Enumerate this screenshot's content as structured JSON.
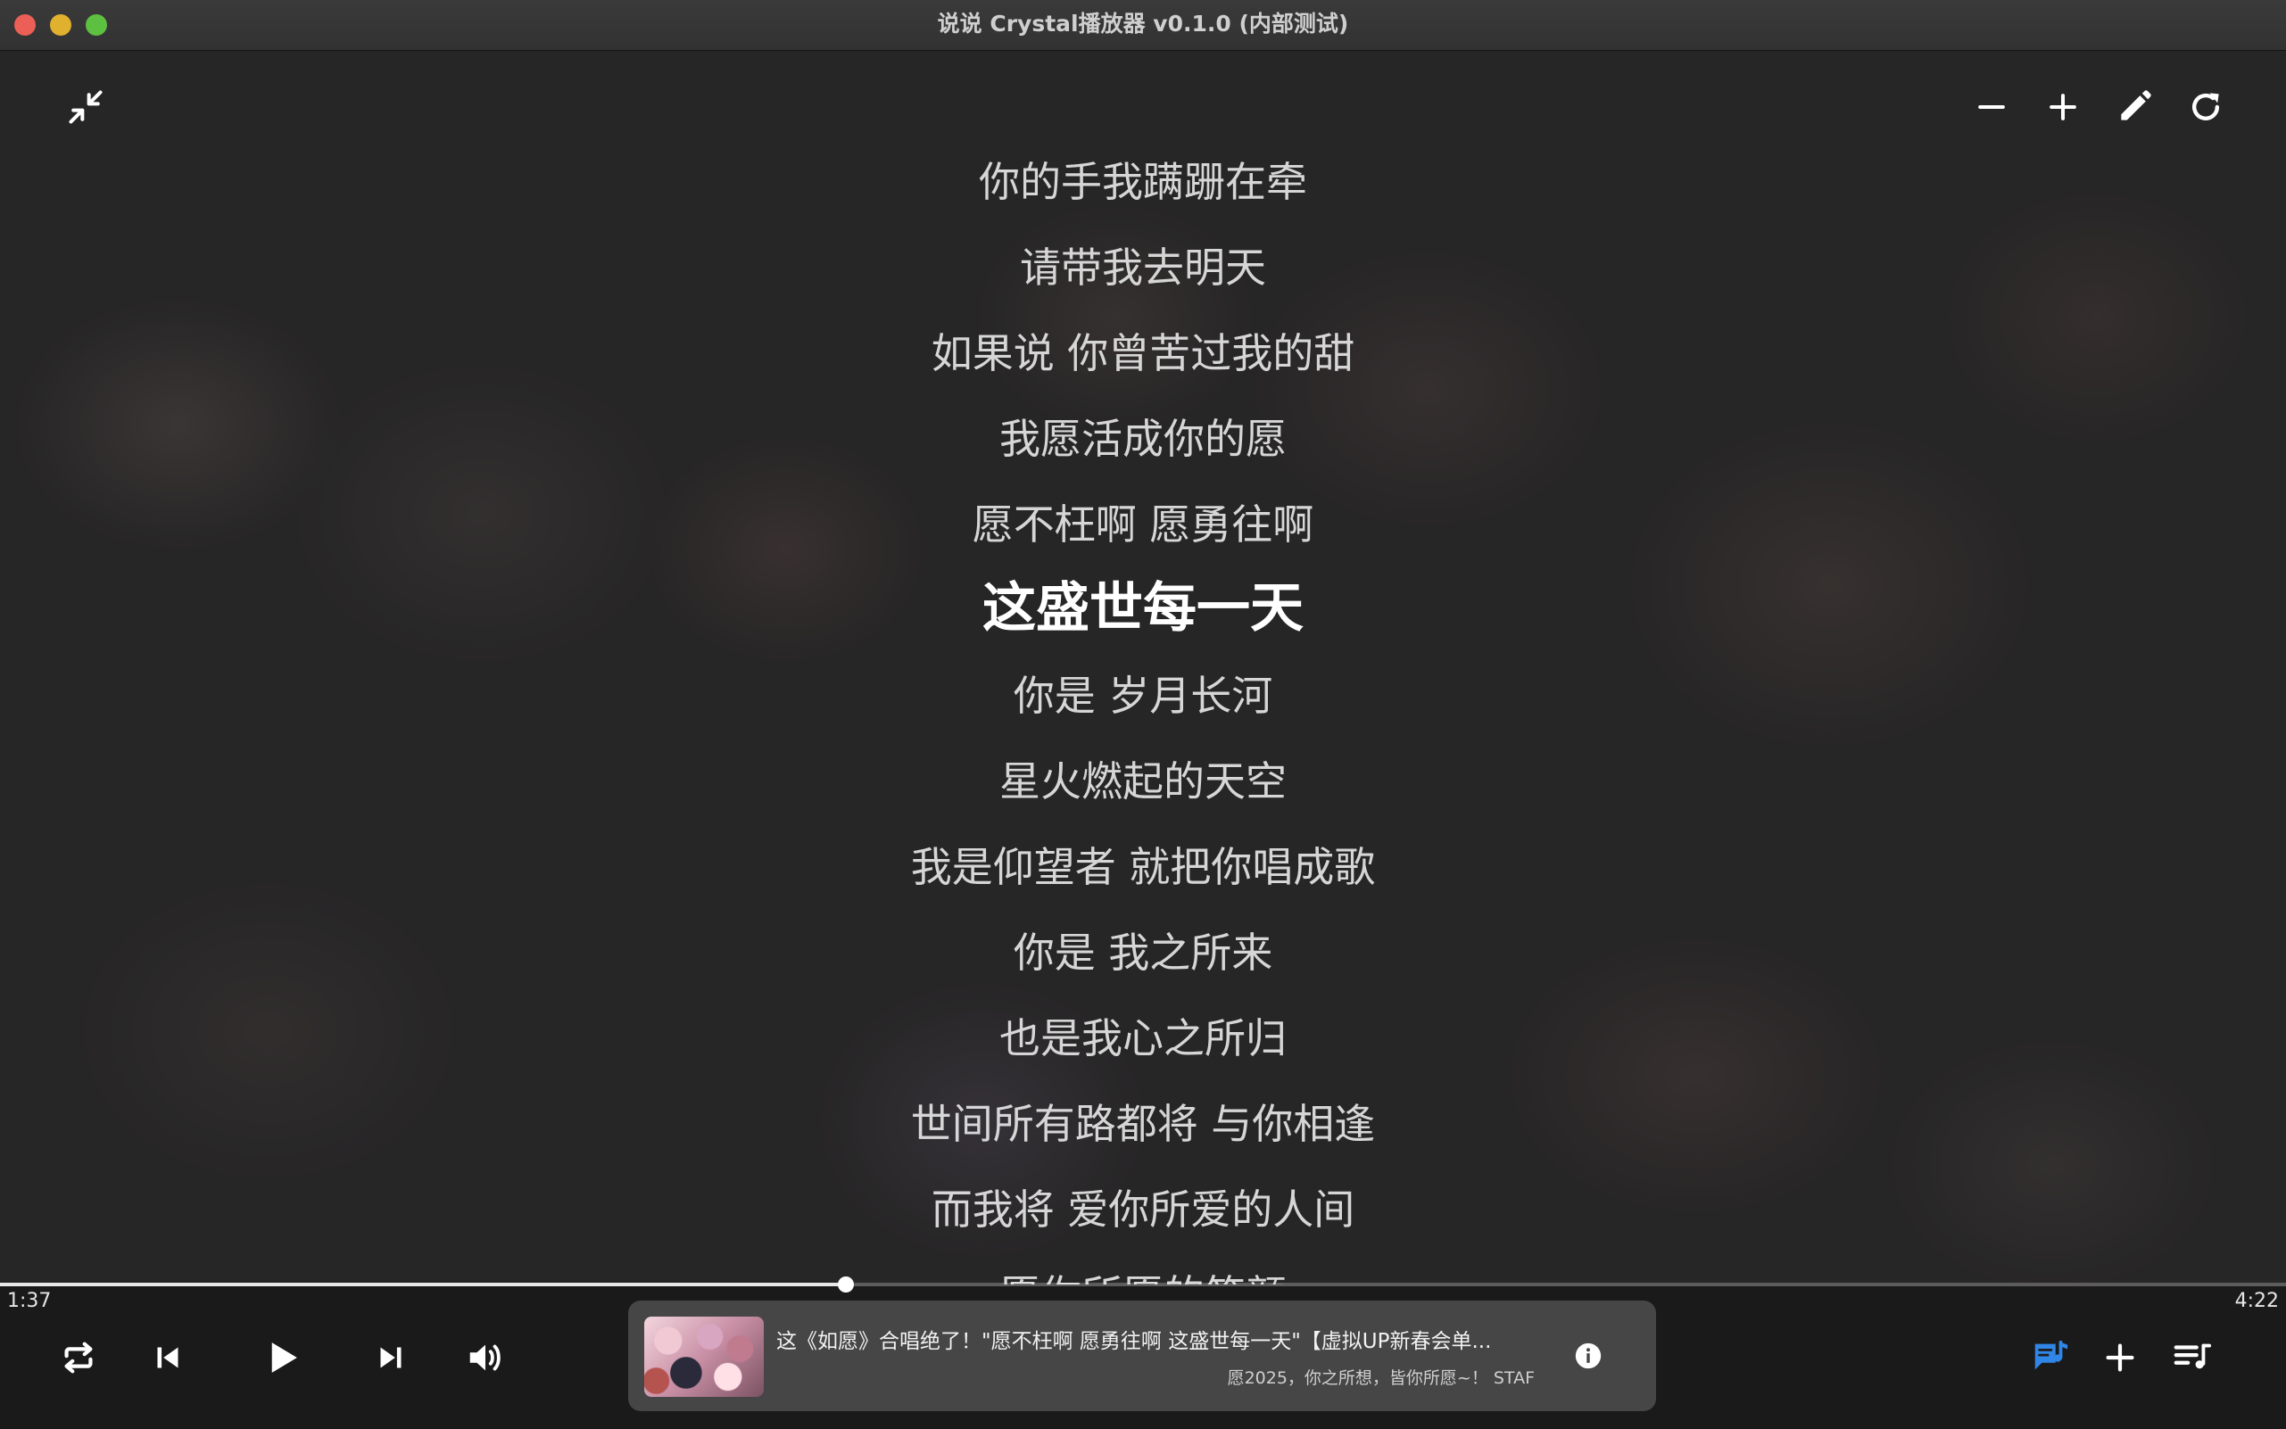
{
  "window": {
    "title": "说说 Crystal播放器 v0.1.0 (内部测试)"
  },
  "lyrics": {
    "lines": [
      "你的手我蹒跚在牵",
      "请带我去明天",
      "如果说 你曾苦过我的甜",
      "我愿活成你的愿",
      "愿不枉啊 愿勇往啊",
      "这盛世每一天",
      "你是 岁月长河",
      "星火燃起的天空",
      "我是仰望者 就把你唱成歌",
      "你是 我之所来",
      "也是我心之所归",
      "世间所有路都将 与你相逢",
      "而我将 爱你所爱的人间",
      "愿你所愿的笑颜"
    ],
    "active_index": 5
  },
  "player": {
    "elapsed": "1:37",
    "total": "4:22",
    "progress_fraction": 0.37,
    "now_playing": {
      "title": "这《如愿》合唱绝了！\"愿不枉啊 愿勇往啊 这盛世每一天\"【虚拟UP新春会单...",
      "subtitle": "愿2025，你之所想，皆你所愿~！ STAF"
    }
  },
  "colors": {
    "accent": "#2f86e6",
    "text": "#d6d6d6",
    "active_text": "#ffffff"
  },
  "icons": {
    "collapse": "collapse-arrows-icon",
    "font_minus": "minus-icon",
    "font_plus": "plus-icon",
    "edit": "pencil-icon",
    "refresh": "refresh-icon",
    "repeat": "repeat-icon",
    "prev": "skip-previous-icon",
    "play": "play-icon",
    "next": "skip-next-icon",
    "volume": "volume-icon",
    "info": "info-icon",
    "lyrics": "lyrics-icon",
    "add": "plus-icon",
    "playlist": "playlist-icon"
  }
}
